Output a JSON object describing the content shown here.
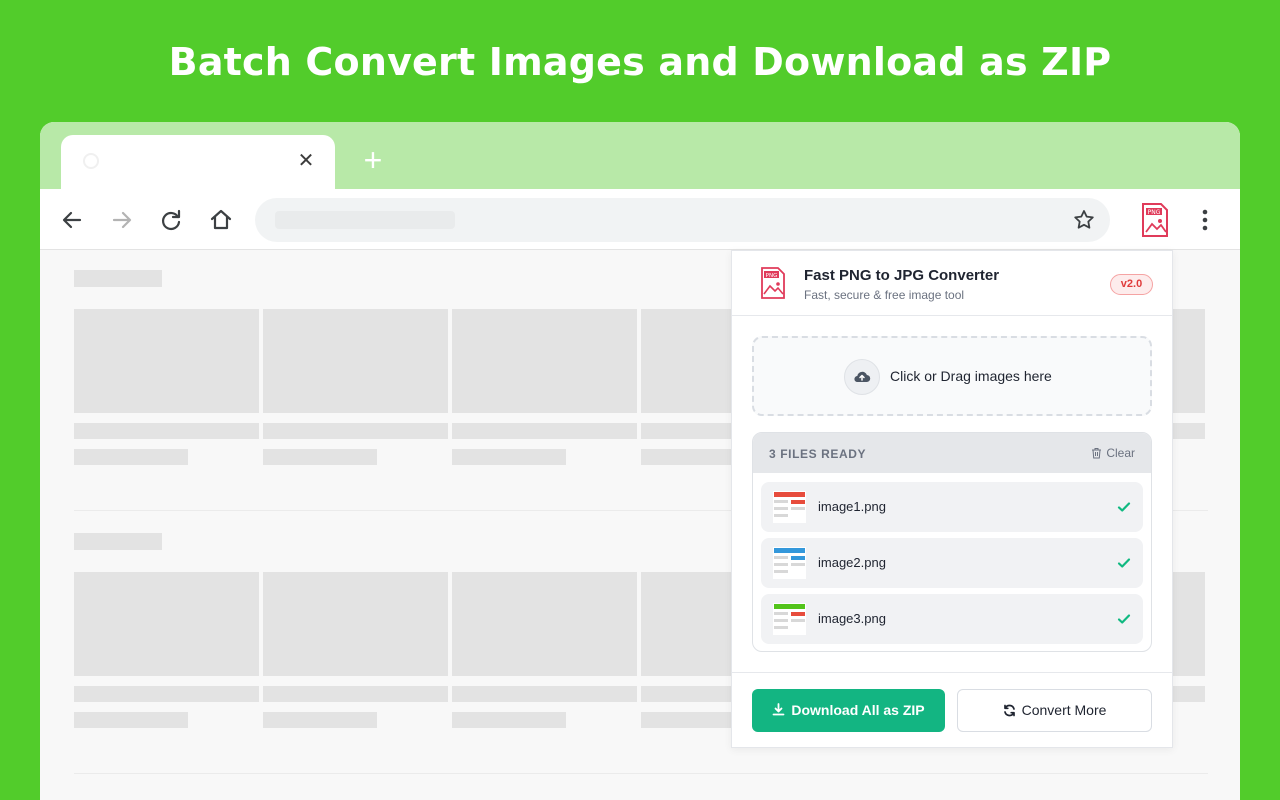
{
  "headline": "Batch Convert Images and Download as ZIP",
  "browser": {
    "tab_close": "✕",
    "new_tab": "+"
  },
  "extension": {
    "title": "Fast PNG to JPG Converter",
    "subtitle": "Fast, secure & free image tool",
    "version": "v2.0",
    "logo_text": "PNG",
    "dropzone_text": "Click or Drag images here",
    "files_header": "3 FILES READY",
    "clear_label": "Clear",
    "files": [
      {
        "name": "image1.png",
        "accent": "#e74c3c"
      },
      {
        "name": "image2.png",
        "accent": "#3498db"
      },
      {
        "name": "image3.png",
        "accent": "#52c41a"
      }
    ],
    "download_button": "Download All as ZIP",
    "convert_button": "Convert More"
  },
  "colors": {
    "background": "#52cc2b",
    "tabbar": "#b8e9a8",
    "primary": "#13b582",
    "badge": "#e03b3b"
  }
}
